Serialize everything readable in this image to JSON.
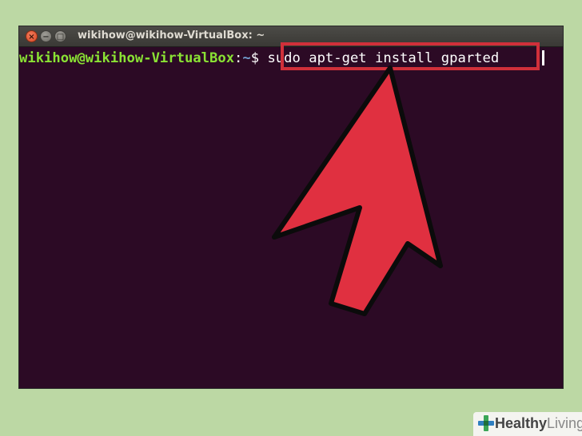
{
  "window": {
    "title": "wikihow@wikihow-VirtualBox: ~",
    "buttons": {
      "close": "×",
      "minimize": "−",
      "maximize": "□"
    }
  },
  "terminal": {
    "prompt_user": "wikihow@wikihow-VirtualBox",
    "prompt_sep": ":",
    "prompt_path": "~",
    "prompt_symbol": "$",
    "command": "sudo apt-get install gparted"
  },
  "colors": {
    "terminal_bg": "#2c0a25",
    "prompt_user": "#8ae234",
    "prompt_path": "#729fcf",
    "highlight": "#d0303a",
    "arrow_fill": "#e03040",
    "page_bg": "#bcd8a4"
  },
  "annotation": {
    "arrow_icon": "big-red-arrow-icon",
    "highlight_box": "command-highlight"
  },
  "watermark": {
    "brand_bold": "Healthy",
    "brand_light": "Living",
    "icon": "plus-cross-icon"
  }
}
